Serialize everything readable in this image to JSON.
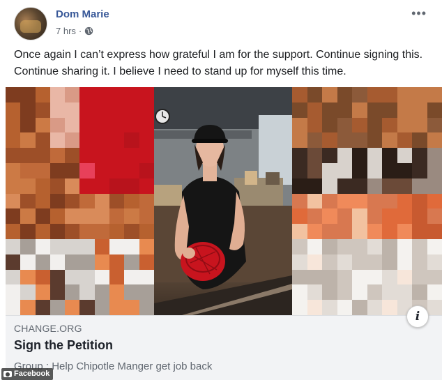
{
  "post": {
    "author": "Dom Marie",
    "time": "7 hrs",
    "separator": "·",
    "privacy_icon": "globe-icon",
    "more_label": "•••",
    "text": "Once again I can’t express how grateful I am for the support. Continue signing this. Continue sharing it. I believe I need to stand up for myself this time."
  },
  "media": {
    "icon": "video-still",
    "info_label": "i"
  },
  "link_preview": {
    "domain": "CHANGE.ORG",
    "title": "Sign the Petition",
    "description": "Group : Help Chipotle Manger get job back"
  },
  "watermark": {
    "label": "Facebook",
    "icon": "camera-icon"
  },
  "colors": {
    "author": "#385898",
    "link_bg": "#f2f3f5",
    "muted": "#606770",
    "cap_red": "#c8141e"
  }
}
